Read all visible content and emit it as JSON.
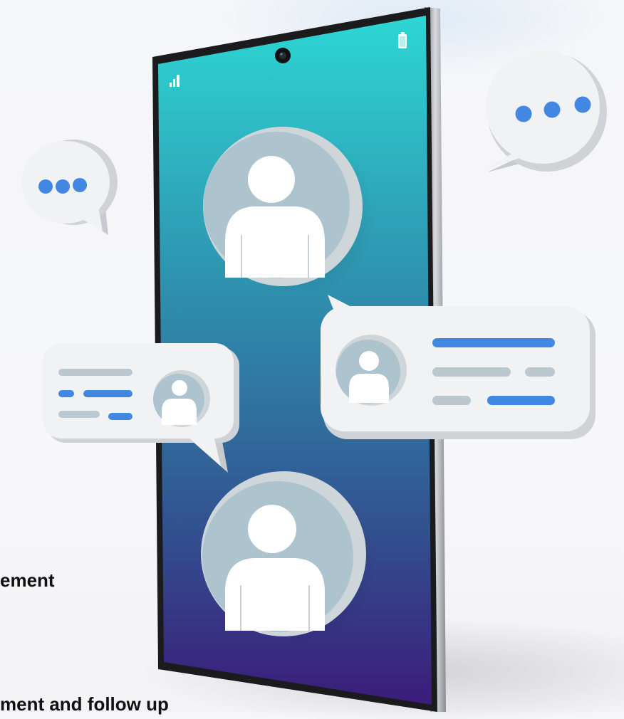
{
  "captions": {
    "line1": "ement",
    "line2": "ment and follow up"
  },
  "colors": {
    "screen_top": "#2dd6d4",
    "screen_mid": "#2e7fa6",
    "screen_bottom": "#3b1c7a",
    "bubble": "#eeeff1",
    "accent_blue": "#4288e3",
    "line_gray": "#bcc8d0",
    "avatar_bg": "#adc4cf"
  },
  "icons": [
    "signal-icon",
    "battery-icon",
    "front-camera-icon",
    "typing-dots-icon",
    "person-avatar-icon"
  ]
}
